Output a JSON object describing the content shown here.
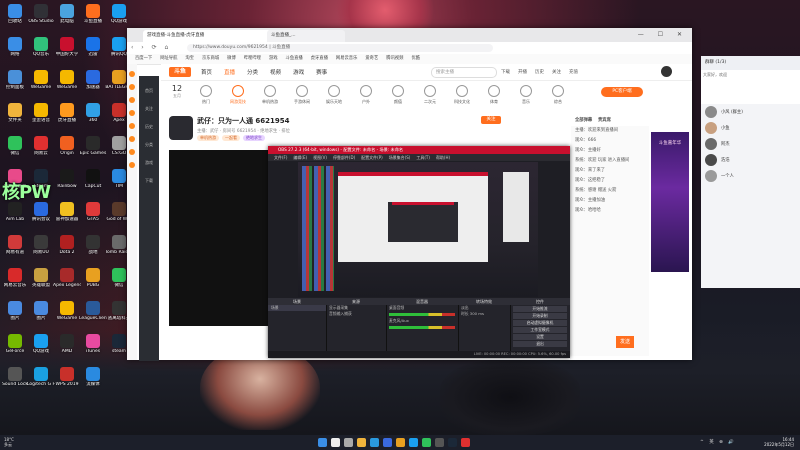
{
  "desktop": {
    "big_text": "核PW",
    "icons": [
      {
        "label": "回收站",
        "color": "#3a8ee6"
      },
      {
        "label": "OBS Studio",
        "color": "#303036"
      },
      {
        "label": "此电脑",
        "color": "#4aa3df"
      },
      {
        "label": "斗鱼直播",
        "color": "#ff6e1e"
      },
      {
        "label": "QQ游戏",
        "color": "#1aa0f0"
      },
      {
        "label": "网络",
        "color": "#3a8ee6"
      },
      {
        "label": "QQ音乐",
        "color": "#31c27c"
      },
      {
        "label": "中国好大学",
        "color": "#c8102e"
      },
      {
        "label": "迅雷",
        "color": "#1a73e8"
      },
      {
        "label": "腾讯QQ",
        "color": "#1aa0f0"
      },
      {
        "label": "控制面板",
        "color": "#4a90d9"
      },
      {
        "label": "WeGame",
        "color": "#f5b800"
      },
      {
        "label": "WeGame",
        "color": "#f5b800"
      },
      {
        "label": "加速器",
        "color": "#2a6ae0"
      },
      {
        "label": "BATTLEGR...",
        "color": "#e8a020"
      },
      {
        "label": "文件夹",
        "color": "#f0b43c"
      },
      {
        "label": "歪歪语音",
        "color": "#f5b800"
      },
      {
        "label": "虎牙直播",
        "color": "#ff9a1e"
      },
      {
        "label": "360",
        "color": "#31a0e6"
      },
      {
        "label": "Apex",
        "color": "#c8302a"
      },
      {
        "label": "微信",
        "color": "#2fc25b"
      },
      {
        "label": "网易云",
        "color": "#e03030"
      },
      {
        "label": "Origin",
        "color": "#f06020"
      },
      {
        "label": "Epic Games",
        "color": "#2a2a2a"
      },
      {
        "label": "CS:GO",
        "color": "#a0a0a0"
      },
      {
        "label": "网络加速器",
        "color": "#e84a8a"
      },
      {
        "label": "Steam",
        "color": "#1b2838"
      },
      {
        "label": "Rainbow",
        "color": "#1a1a1a"
      },
      {
        "label": "CapCut",
        "color": "#111"
      },
      {
        "label": "TIM",
        "color": "#2a8ae0"
      },
      {
        "label": "Aim Lab",
        "color": "#222"
      },
      {
        "label": "腾讯会议",
        "color": "#2a6ae0"
      },
      {
        "label": "雷神加速器",
        "color": "#f0c020"
      },
      {
        "label": "GTA5",
        "color": "#e03a3a"
      },
      {
        "label": "God of War",
        "color": "#5a3a2a"
      },
      {
        "label": "网易有道",
        "color": "#d03a3a"
      },
      {
        "label": "网易UU",
        "color": "#3a3a3a"
      },
      {
        "label": "Dota 2",
        "color": "#b02020"
      },
      {
        "label": "战地",
        "color": "#333"
      },
      {
        "label": "Tomb Raider",
        "color": "#6a6a6a"
      },
      {
        "label": "网易云音乐",
        "color": "#d82a2a"
      },
      {
        "label": "英雄联盟",
        "color": "#c8a040"
      },
      {
        "label": "Apex Legends",
        "color": "#a82a2a"
      },
      {
        "label": "PUBG",
        "color": "#e8a020"
      },
      {
        "label": "微信",
        "color": "#2fc25b"
      },
      {
        "label": "图片",
        "color": "#4a8ae0"
      },
      {
        "label": "图片",
        "color": "#4a8ae0"
      },
      {
        "label": "WeGame",
        "color": "#f5b800"
      },
      {
        "label": "LeagueClient",
        "color": "#2a5a9a"
      },
      {
        "label": "逃离塔科夫",
        "color": "#333"
      },
      {
        "label": "GeForce",
        "color": "#76b900"
      },
      {
        "label": "QQ游戏",
        "color": "#1aa0f0"
      },
      {
        "label": "AMD",
        "color": "#2a2a2a"
      },
      {
        "label": "iTunes",
        "color": "#e84aa0"
      },
      {
        "label": "steam",
        "color": "#1b2838"
      },
      {
        "label": "Sound Lock",
        "color": "#555"
      },
      {
        "label": "Logitech G HUB",
        "color": "#1aa0e0"
      },
      {
        "label": "WPS 2019",
        "color": "#c8302a"
      },
      {
        "label": "流媒体",
        "color": "#2a8ae0"
      }
    ]
  },
  "browser": {
    "tabs": [
      "游戏直播-斗鱼直播-虎牙直播",
      "斗鱼直播_..."
    ],
    "url": "https://www.douyu.com/9621954 | 斗鱼直播",
    "bookmarks": [
      "百度一下",
      "网址导航",
      "淘宝",
      "京东商城",
      "微博",
      "哔哩哔哩",
      "游戏",
      "斗鱼直播",
      "虎牙直播",
      "网易云音乐",
      "爱奇艺",
      "腾讯视频",
      "优酷"
    ],
    "window_buttons": "— ☐ ✕"
  },
  "huya": {
    "logo": "斗鱼",
    "nav": [
      "首页",
      "直播",
      "分类",
      "视频",
      "游戏",
      "赛事"
    ],
    "active_nav": "直播",
    "search_placeholder": "搜索主播",
    "header_right": [
      "下载",
      "开播",
      "历史",
      "关注",
      "充值"
    ],
    "date_number": "12",
    "date_label": "五月",
    "categories": [
      "热门",
      "网游竞技",
      "单机热游",
      "手游休闲",
      "娱乐天地",
      "户外",
      "颜值",
      "二次元",
      "科技文化",
      "体育",
      "音乐",
      "综合"
    ],
    "active_category": "网游竞技",
    "pc_button": "PC客户端",
    "streamer_title": "武仔：只为一人通 6621954",
    "streamer_sub": "主播：武仔 · 房间号 6621954 · 绝地求生 · 排位",
    "badges": [
      "单机热游",
      "一起看",
      "绝地求生"
    ],
    "follow": "关注",
    "chat_tabs": [
      "全部弹幕",
      "贵宾席"
    ],
    "chat_lines": [
      "主播：欢迎来到直播间",
      "观众：666",
      "观众：主播好",
      "系统：欢迎 玩家 进入直播间",
      "观众：来了来了",
      "观众：这把稳了",
      "系统：感谢 赠送 火箭",
      "观众：主播加油",
      "观众：哈哈哈"
    ],
    "ad_text": "斗鱼嘉年华",
    "send": "发送",
    "sidebar_items": [
      "首页",
      "关注",
      "历史",
      "分类",
      "游戏",
      "下载"
    ]
  },
  "obs": {
    "title": "OBS 27.2.3 (64-bit, windows) - 配置文件: 未命名 - 场景: 未命名",
    "menu": [
      "文件(F)",
      "编辑(E)",
      "视图(V)",
      "停靠部件(D)",
      "配置文件(P)",
      "场景集合(S)",
      "工具(T)",
      "帮助(H)"
    ],
    "docks": {
      "scenes": {
        "title": "场景",
        "items": [
          "场景"
        ]
      },
      "sources": {
        "title": "来源",
        "items": [
          "显示器采集",
          "音频输入捕获"
        ]
      },
      "mixer": {
        "title": "混音器",
        "items": [
          "桌面音频",
          "麦克风/Aux"
        ]
      },
      "transitions": {
        "title": "转场特效",
        "items": [
          "淡出",
          "时长 300 ms"
        ]
      },
      "controls": {
        "title": "控件",
        "buttons": [
          "开始推流",
          "开始录制",
          "启动虚拟摄像机",
          "工作室模式",
          "设置",
          "退出"
        ]
      }
    },
    "status": "LIVE: 00:00:00   REC: 00:00:00   CPU: 5.6%, 60.00 fps",
    "dock_header": "来源选择"
  },
  "qq": {
    "header": "群聊 (1/3)",
    "gift_text": "大家好，欢迎",
    "members": [
      {
        "name": "小风 (群主)",
        "color": "#8a8a8a"
      },
      {
        "name": "小鱼",
        "color": "#c8a080"
      },
      {
        "name": "阿杰",
        "color": "#6a6a6a"
      },
      {
        "name": "浩浩",
        "color": "#4a4a4a"
      },
      {
        "name": "一个人",
        "color": "#9a9a9a"
      }
    ]
  },
  "taskbar": {
    "left_top": "18°C",
    "left_bottom": "多云",
    "clock_time": "16:44",
    "clock_date": "2022年5月12日",
    "tray": "^ 英 ⊕ 🔊",
    "apps": [
      {
        "name": "start",
        "color": "#3a8ee6"
      },
      {
        "name": "search",
        "color": "#eee"
      },
      {
        "name": "task-view",
        "color": "#aaa"
      },
      {
        "name": "explorer",
        "color": "#f0b43c"
      },
      {
        "name": "edge",
        "color": "#2a9ae0"
      },
      {
        "name": "store",
        "color": "#3a6ae0"
      },
      {
        "name": "chrome",
        "color": "#e8a020"
      },
      {
        "name": "qq",
        "color": "#1aa0f0"
      },
      {
        "name": "wechat",
        "color": "#2fc25b"
      },
      {
        "name": "obs",
        "color": "#555"
      },
      {
        "name": "steam",
        "color": "#1b2838"
      },
      {
        "name": "music",
        "color": "#e03030"
      }
    ]
  }
}
